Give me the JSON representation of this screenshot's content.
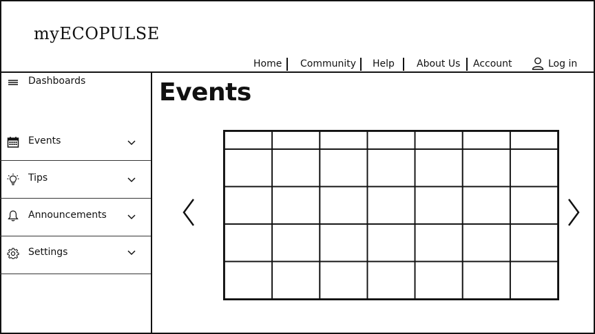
{
  "brand": {
    "logo": "myECOPULSE"
  },
  "nav": {
    "items": [
      {
        "label": "Home"
      },
      {
        "label": "Community"
      },
      {
        "label": "Help"
      },
      {
        "label": "About Us"
      },
      {
        "label": "Account"
      }
    ],
    "login_label": "Log in",
    "login_icon": "user-icon"
  },
  "sidebar": {
    "dashboard": {
      "label": "Dashboards",
      "icon": "menu-icon"
    },
    "items": [
      {
        "label": "Events",
        "icon": "calendar-icon"
      },
      {
        "label": "Tips",
        "icon": "lightbulb-icon"
      },
      {
        "label": "Announcements",
        "icon": "bell-icon"
      },
      {
        "label": "Settings",
        "icon": "gear-icon"
      }
    ]
  },
  "main": {
    "title": "Events",
    "calendar": {
      "columns": 7,
      "rows": 4
    },
    "prev_icon": "chevron-left-icon",
    "next_icon": "chevron-right-icon"
  }
}
